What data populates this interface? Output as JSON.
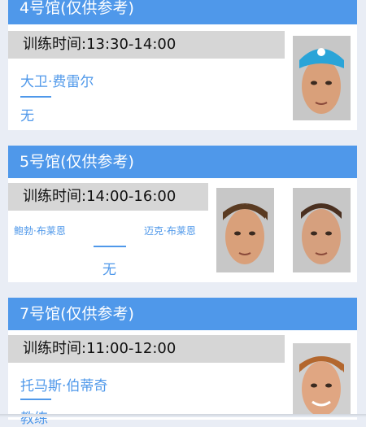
{
  "courts": [
    {
      "title": "4号馆(仅供参考)",
      "time": "训练时间:13:30-14:00",
      "players": [
        "大卫·费雷尔"
      ],
      "coach": "无",
      "photos": [
        "player-david-ferrer-photo"
      ]
    },
    {
      "title": "5号馆(仅供参考)",
      "time": "训练时间:14:00-16:00",
      "players": [
        "鲍勃·布莱恩",
        "迈克·布莱恩"
      ],
      "coach": "无",
      "photos": [
        "player-bob-bryan-photo",
        "player-mike-bryan-photo"
      ]
    },
    {
      "title": "7号馆(仅供参考)",
      "time": "训练时间:11:00-12:00",
      "players": [
        "托马斯·伯蒂奇"
      ],
      "coach": "教练",
      "photos": [
        "player-tomas-berdych-photo"
      ]
    }
  ],
  "colors": {
    "accent": "#4f98ea",
    "background": "#e9edf5",
    "time_bar": "#d6d6d6"
  }
}
